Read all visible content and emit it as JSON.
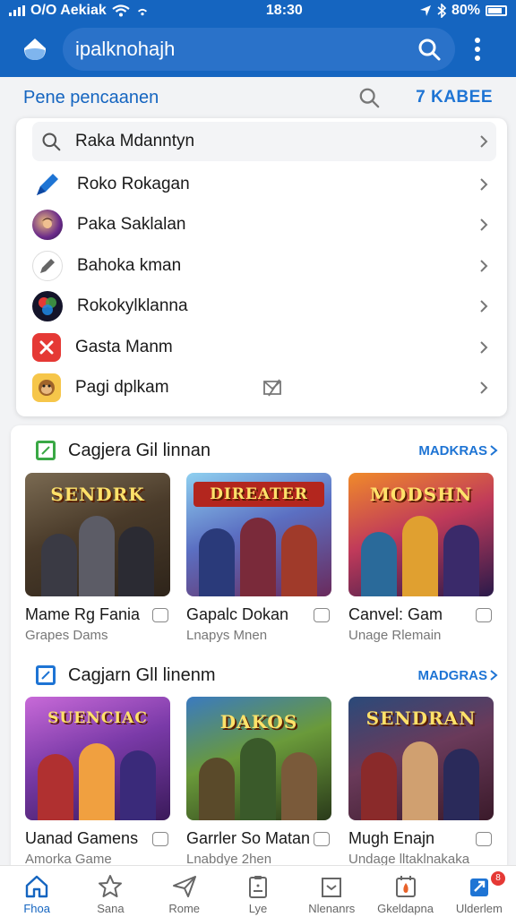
{
  "status_bar": {
    "carrier": "O/O Aekiak",
    "time": "18:30",
    "battery": "80%"
  },
  "app_bar": {
    "search_query": "ipalknohajh"
  },
  "recent_bar": {
    "title": "Pene pencaanen",
    "clear_label": "7 KABEE"
  },
  "dropdown": {
    "search_text": "Raka Mdanntyn",
    "items": [
      {
        "label": "Roko Rokagan",
        "icon": "pen-icon"
      },
      {
        "label": "Paka Saklalan",
        "icon": "game-avatar-icon"
      },
      {
        "label": "Bahoka kman",
        "icon": "pencil-icon"
      },
      {
        "label": "Rokokylklanna",
        "icon": "colorful-orb-icon"
      },
      {
        "label": "Gasta Manm",
        "icon": "red-x-app-icon"
      },
      {
        "label": "Pagi dplkam",
        "icon": "monkey-app-icon"
      }
    ]
  },
  "sections": [
    {
      "title": "Cagjera Gil linnan",
      "more": "MADKRAS",
      "games": [
        {
          "name": "Mame Rg Fania",
          "sub": "Grapes Dams",
          "art": "SENDRK"
        },
        {
          "name": "Gapalc Dokan",
          "sub": "Lnapys Mnen",
          "art": "DIREATER"
        },
        {
          "name": "Canvel: Gam",
          "sub": "Unage Rlemain",
          "art": "MODSHN"
        }
      ]
    },
    {
      "title": "Cagjarn Gll linenm",
      "more": "MADGRAS",
      "games": [
        {
          "name": "Uanad Gamens",
          "sub": "Amorka Game",
          "art": "SUENCIAC"
        },
        {
          "name": "Garrler So Matan",
          "sub": "Lnabdye 2hen",
          "art": "DAKOS"
        },
        {
          "name": "Mugh Enajn",
          "sub": "Undage lltaklnakaka",
          "art": "SENDRAN"
        }
      ]
    }
  ],
  "nav": [
    {
      "label": "Fhoa",
      "icon": "home-icon",
      "active": true
    },
    {
      "label": "Sana",
      "icon": "star-icon"
    },
    {
      "label": "Rome",
      "icon": "send-icon"
    },
    {
      "label": "Lye",
      "icon": "clipboard-icon"
    },
    {
      "label": "Nlenanrs",
      "icon": "book-icon"
    },
    {
      "label": "Gkeldapna",
      "icon": "fire-calendar-icon"
    },
    {
      "label": "Ulderlem",
      "icon": "updates-icon",
      "badge": "8"
    }
  ],
  "colors": {
    "primary": "#1565c0",
    "accent": "#1e74d4",
    "section_green": "#3aa845",
    "section_blue": "#1e74d4"
  }
}
